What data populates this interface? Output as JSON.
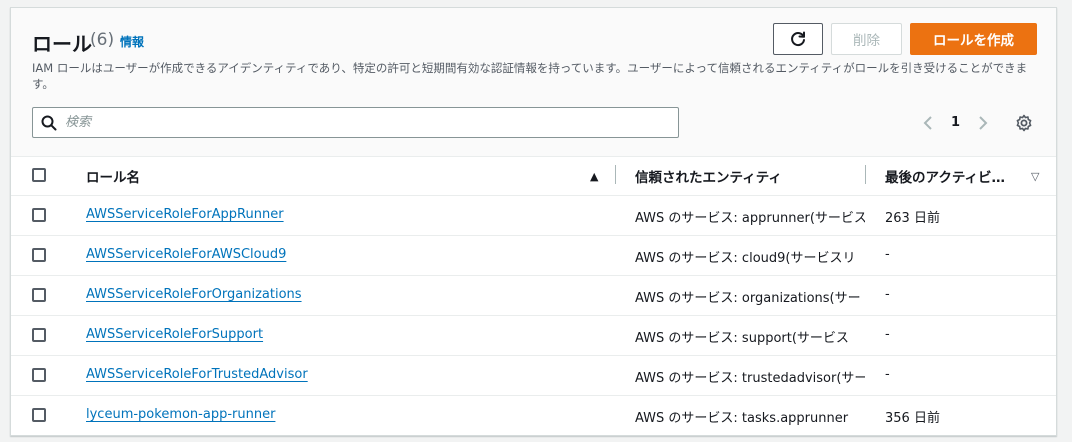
{
  "header": {
    "title": "ロール",
    "count": "(6)",
    "info_label": "情報",
    "description": "IAM ロールはユーザーが作成できるアイデンティティであり、特定の許可と短期間有効な認証情報を持っています。ユーザーによって信頼されるエンティティがロールを引き受けることができます。",
    "refresh_icon": "refresh-icon",
    "delete_label": "削除",
    "create_label": "ロールを作成"
  },
  "search": {
    "placeholder": "検索",
    "value": ""
  },
  "pagination": {
    "current_page": "1"
  },
  "table": {
    "columns": [
      {
        "label": "ロール名",
        "sort": "ascending"
      },
      {
        "label": "信頼されたエンティティ"
      },
      {
        "label": "最後のアクティビ…",
        "sort": "descending"
      }
    ],
    "rows": [
      {
        "name": "AWSServiceRoleForAppRunner",
        "entity_prefix": "AWS のサービス: apprunner",
        "entity_suffix": "(サービス",
        "last": "263 日前"
      },
      {
        "name": "AWSServiceRoleForAWSCloud9",
        "entity_prefix": "AWS のサービス: cloud9",
        "entity_suffix": "(サービスリ",
        "last": "-"
      },
      {
        "name": "AWSServiceRoleForOrganizations",
        "entity_prefix": "AWS のサービス: organizations",
        "entity_suffix": "(サー",
        "last": "-"
      },
      {
        "name": "AWSServiceRoleForSupport",
        "entity_prefix": "AWS のサービス: support",
        "entity_suffix": "(サービス",
        "last": "-"
      },
      {
        "name": "AWSServiceRoleForTrustedAdvisor",
        "entity_prefix": "AWS のサービス: trustedadvisor",
        "entity_suffix": "(サー",
        "last": "-"
      },
      {
        "name": "lyceum-pokemon-app-runner",
        "entity_prefix": "AWS のサービス: tasks.apprunner",
        "entity_suffix": "",
        "last": "356 日前"
      }
    ]
  },
  "colors": {
    "accent": "#ec7211",
    "link": "#0073bb",
    "text": "#16191f",
    "muted": "#545b64"
  }
}
